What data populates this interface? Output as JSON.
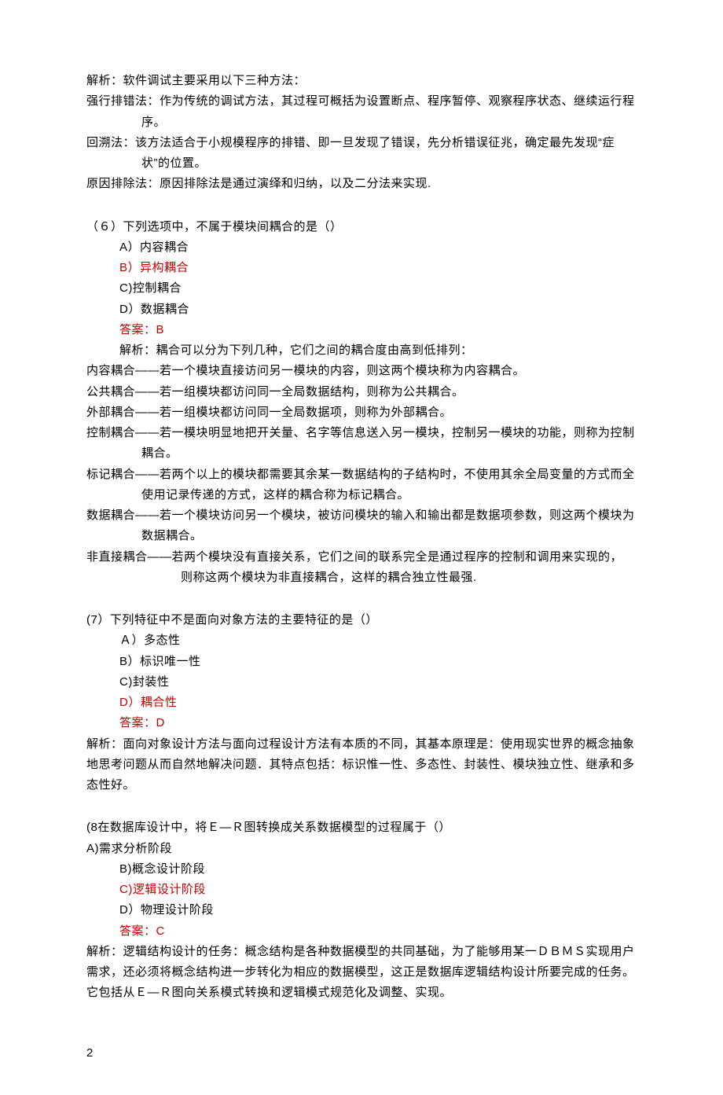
{
  "explain5": {
    "lead": "解析：软件调试主要采用以下三种方法：",
    "m1": "强行排错法：作为传统的调试方法，其过程可概括为设置断点、程序暂停、观察程序状态、继续运行程序。",
    "m2": "回溯法：该方法适合于小规模程序的排错、即一旦发现了错误，先分析错误征兆，确定最先发现“症状”的位置。",
    "m3": "原因排除法：原因排除法是通过演绎和归纳，以及二分法来实现."
  },
  "q6": {
    "stem": "（６）下列选项中，不属于模块间耦合的是（）",
    "a": "A）内容耦合",
    "b": "B）异构耦合",
    "c": "C)控制耦合",
    "d": "D）数据耦合",
    "answer": "答案：B",
    "exp_lead": "解析：耦合可以分为下列几种，它们之间的耦合度由高到低排列：",
    "c1": "内容耦合——若一个模块直接访问另一模块的内容，则这两个模块称为内容耦合。",
    "c2": "公共耦合——若一组模块都访问同一全局数据结构，则称为公共耦合。",
    "c3": "外部耦合——若一组模块都访问同一全局数据项，则称为外部耦合。",
    "c4": "控制耦合——若一模块明显地把开关量、名字等信息送入另一模块，控制另一模块的功能，则称为控制耦合。",
    "c5": "标记耦合——若两个以上的模块都需要其余某一数据结构的子结构时，不使用其余全局变量的方式而全使用记录传递的方式，这样的耦合称为标记耦合。",
    "c6": "数据耦合——若一个模块访问另一个模块，被访问模块的输入和输出都是数据项参数，则这两个模块为数据耦合。",
    "c7a": "非直接耦合——若两个模块没有直接关系，它们之间的联系完全是通过程序的控制和调用来实现的，",
    "c7b": "则称这两个模块为非直接耦合，这样的耦合独立性最强."
  },
  "q7": {
    "stem": "(7）下列特征中不是面向对象方法的主要特征的是（）",
    "a": "Ａ）多态性",
    "b": "B）标识唯一性",
    "c": "C)封装性",
    "d": "D）耦合性",
    "answer": "答案：D",
    "exp": "解析：面向对象设计方法与面向过程设计方法有本质的不同，其基本原理是：使用现实世界的概念抽象地思考问题从而自然地解决问题．其特点包括：标识惟一性、多态性、封装性、模块独立性、继承和多态性好。"
  },
  "q8": {
    "stem": "(8在数据库设计中，将Ｅ—Ｒ图转换成关系数据模型的过程属于（）",
    "a": "A)需求分析阶段",
    "b": "B)概念设计阶段",
    "c": "C)逻辑设计阶段",
    "d": "D）物理设计阶段",
    "answer": "答案：C",
    "exp": "解析：逻辑结构设计的任务：概念结构是各种数据模型的共同基础，为了能够用某一ＤＢＭＳ实现用户需求，还必须将概念结构进一步转化为相应的数据模型，这正是数据库逻辑结构设计所要完成的任务。它包括从Ｅ—Ｒ图向关系模式转换和逻辑模式规范化及调整、实现。"
  },
  "page_number": "2"
}
